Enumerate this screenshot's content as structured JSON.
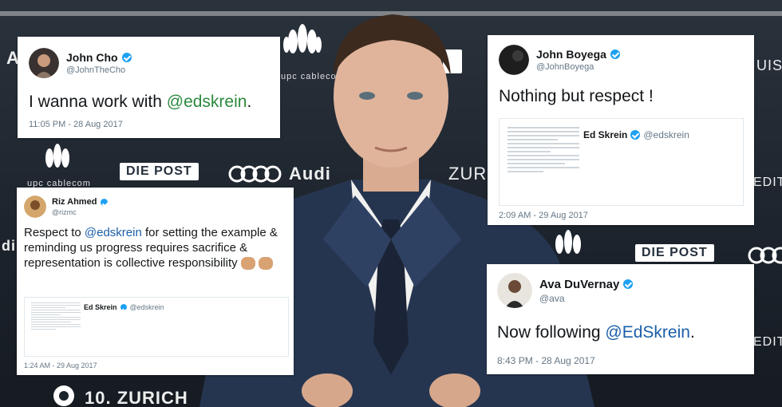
{
  "tweets": [
    {
      "name": "John Cho",
      "handle": "@JohnTheCho",
      "text": "I wanna work with ",
      "mention": "@edskrein",
      "suffix": ".",
      "time": "11:05 PM - 28 Aug 2017"
    },
    {
      "name": "John Boyega",
      "handle": "@JohnBoyega",
      "text": "Nothing but respect !",
      "embed": {
        "name": "Ed Skrein",
        "handle": "@edskrein"
      },
      "time": "2:09 AM - 29 Aug 2017"
    },
    {
      "name": "Riz Ahmed",
      "handle": "@rizmc",
      "text_a": "Respect to ",
      "mention": "@edskrein",
      "text_b": " for setting the example & reminding us progress requires sacrifice & representation is collective responsibility",
      "embed": {
        "name": "Ed Skrein",
        "handle": "@edskrein"
      },
      "time": "1:24 AM - 29 Aug 2017"
    },
    {
      "name": "Ava DuVernay",
      "handle": "@ava",
      "text": "Now following ",
      "mention": "@EdSkrein",
      "suffix": ".",
      "time": "8:43 PM - 28 Aug 2017"
    }
  ],
  "backdrop": {
    "sponsors": [
      "upc cablecom",
      "DIE POST",
      "Audi",
      "ZURICH",
      "10. ZURICH",
      "EDIT",
      "UIS"
    ]
  },
  "colors": {
    "twitter_blue": "#1da1f2",
    "handle_grey": "#657786",
    "backdrop": "#1f2630"
  }
}
